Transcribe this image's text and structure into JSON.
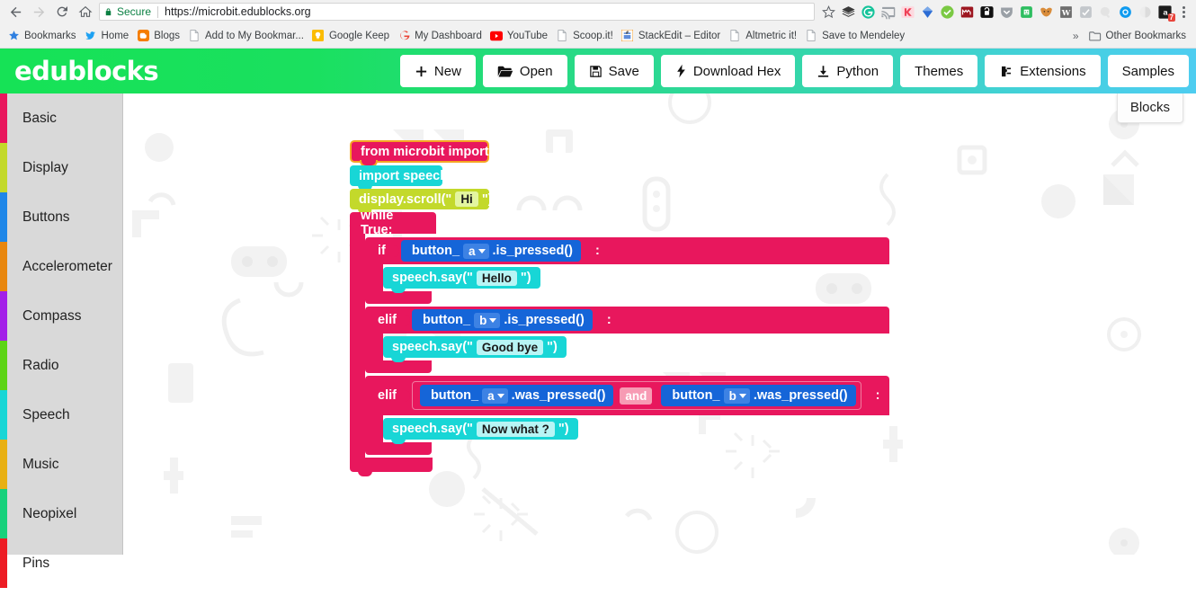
{
  "browser": {
    "nav": {
      "back": "back-arrow",
      "forward": "forward-arrow",
      "reload": "reload-icon",
      "home": "home-icon"
    },
    "omnibox": {
      "security_label": "Secure",
      "url": "https://microbit.edublocks.org",
      "security_color": "#0b8043"
    },
    "bookmark_star": "star-icon",
    "extensions": [
      {
        "name": "pocket-icon"
      },
      {
        "name": "grammarly-icon"
      },
      {
        "name": "cast-icon"
      },
      {
        "name": "kami-icon"
      },
      {
        "name": "diigo-icon"
      },
      {
        "name": "checkmark-icon"
      },
      {
        "name": "mendeley-icon"
      },
      {
        "name": "lock-unlocked-icon"
      },
      {
        "name": "lastpass-icon"
      },
      {
        "name": "evernote-icon"
      },
      {
        "name": "fox-icon"
      },
      {
        "name": "wikipedia-w-icon"
      },
      {
        "name": "check-gray-icon"
      },
      {
        "name": "search-gray-icon"
      },
      {
        "name": "blue-circle-icon"
      },
      {
        "name": "gray-circle-icon"
      },
      {
        "name": "adblock-icon",
        "badge": "7"
      }
    ],
    "menu": "three-dots-menu",
    "bookmarks": [
      {
        "label": "Bookmarks",
        "icon": "star-blue-icon"
      },
      {
        "label": "Home",
        "icon": "twitter-icon"
      },
      {
        "label": "Blogs",
        "icon": "blogger-icon"
      },
      {
        "label": "Add to My Bookmar...",
        "icon": "page-icon"
      },
      {
        "label": "Google Keep",
        "icon": "keep-icon"
      },
      {
        "label": "My Dashboard",
        "icon": "google-g-icon"
      },
      {
        "label": "YouTube",
        "icon": "youtube-icon"
      },
      {
        "label": "Scoop.it!",
        "icon": "page-icon"
      },
      {
        "label": "StackEdit – Editor",
        "icon": "stackedit-icon"
      },
      {
        "label": "Altmetric it!",
        "icon": "page-icon"
      },
      {
        "label": "Save to Mendeley",
        "icon": "page-icon"
      }
    ],
    "overflow_chevron": "»",
    "other_bookmarks": {
      "label": "Other Bookmarks",
      "icon": "folder-icon"
    }
  },
  "navbar": {
    "logo": "edublocks",
    "gradient_start": "#16e256",
    "gradient_end": "#4ecdf0",
    "buttons": [
      {
        "label": "New",
        "icon": "plus-icon"
      },
      {
        "label": "Open",
        "icon": "folder-open-icon"
      },
      {
        "label": "Save",
        "icon": "floppy-disk-icon"
      },
      {
        "label": "Download Hex",
        "icon": "lightning-bolt-icon"
      },
      {
        "label": "Python",
        "icon": "download-icon"
      },
      {
        "label": "Themes",
        "icon": ""
      },
      {
        "label": "Extensions",
        "icon": "puzzle-plug-icon"
      },
      {
        "label": "Samples",
        "icon": ""
      }
    ]
  },
  "sidebar": {
    "background": "#d9d9d9",
    "items": [
      {
        "label": "Basic",
        "color": "#e8175d"
      },
      {
        "label": "Display",
        "color": "#c3d92b"
      },
      {
        "label": "Buttons",
        "color": "#1f87e8"
      },
      {
        "label": "Accelerometer",
        "color": "#e8870f"
      },
      {
        "label": "Compass",
        "color": "#a320e8"
      },
      {
        "label": "Radio",
        "color": "#5dd416"
      },
      {
        "label": "Speech",
        "color": "#18d6d6"
      },
      {
        "label": "Music",
        "color": "#e8b013"
      },
      {
        "label": "Neopixel",
        "color": "#17d17c"
      },
      {
        "label": "Pins",
        "color": "#ed1c24"
      }
    ]
  },
  "canvas": {
    "blocks_tab": "Blocks"
  },
  "program": {
    "blocks": [
      {
        "id": "import-microbit",
        "kind": "statement",
        "color": "#e8175d",
        "outline": "#f5a623",
        "text": "from microbit import *"
      },
      {
        "id": "import-speech",
        "kind": "statement",
        "color": "#18d6d6",
        "text": "import speech"
      },
      {
        "id": "display-scroll",
        "kind": "statement",
        "color": "#c3d92b",
        "prefix": "display.scroll(\"",
        "field": "Hi",
        "suffix": "\")"
      },
      {
        "id": "while-true",
        "kind": "c-block",
        "color": "#e8175d",
        "header": "while True:",
        "children": [
          {
            "id": "if-button-a",
            "kind": "c-block",
            "color": "#e8175d",
            "keyword": "if",
            "colon": ":",
            "condition": {
              "kind": "value",
              "color": "#1565d8",
              "prefix": "button_",
              "dropdown": "a",
              "suffix": ".is_pressed()"
            },
            "children": [
              {
                "id": "speech-say-hello",
                "kind": "statement",
                "color": "#18d6d6",
                "prefix": "speech.say(\"",
                "field": "Hello",
                "suffix": "\")"
              }
            ]
          },
          {
            "id": "elif-button-b",
            "kind": "c-block",
            "color": "#e8175d",
            "keyword": "elif",
            "colon": ":",
            "condition": {
              "kind": "value",
              "color": "#1565d8",
              "prefix": "button_",
              "dropdown": "b",
              "suffix": ".is_pressed()"
            },
            "children": [
              {
                "id": "speech-say-goodbye",
                "kind": "statement",
                "color": "#18d6d6",
                "prefix": "speech.say(\"",
                "field": "Good bye",
                "suffix": "\")"
              }
            ]
          },
          {
            "id": "elif-both-was-pressed",
            "kind": "c-block",
            "color": "#e8175d",
            "keyword": "elif",
            "colon": ":",
            "condition": {
              "kind": "logic",
              "operator": "and",
              "operator_color": "#f79bb4",
              "left": {
                "kind": "value",
                "color": "#1565d8",
                "prefix": "button_",
                "dropdown": "a",
                "suffix": ".was_pressed()"
              },
              "right": {
                "kind": "value",
                "color": "#1565d8",
                "prefix": "button_",
                "dropdown": "b",
                "suffix": ".was_pressed()"
              }
            },
            "children": [
              {
                "id": "speech-say-now-what",
                "kind": "statement",
                "color": "#18d6d6",
                "prefix": "speech.say(\"",
                "field": "Now what ?",
                "suffix": "\")"
              }
            ]
          }
        ]
      }
    ]
  }
}
